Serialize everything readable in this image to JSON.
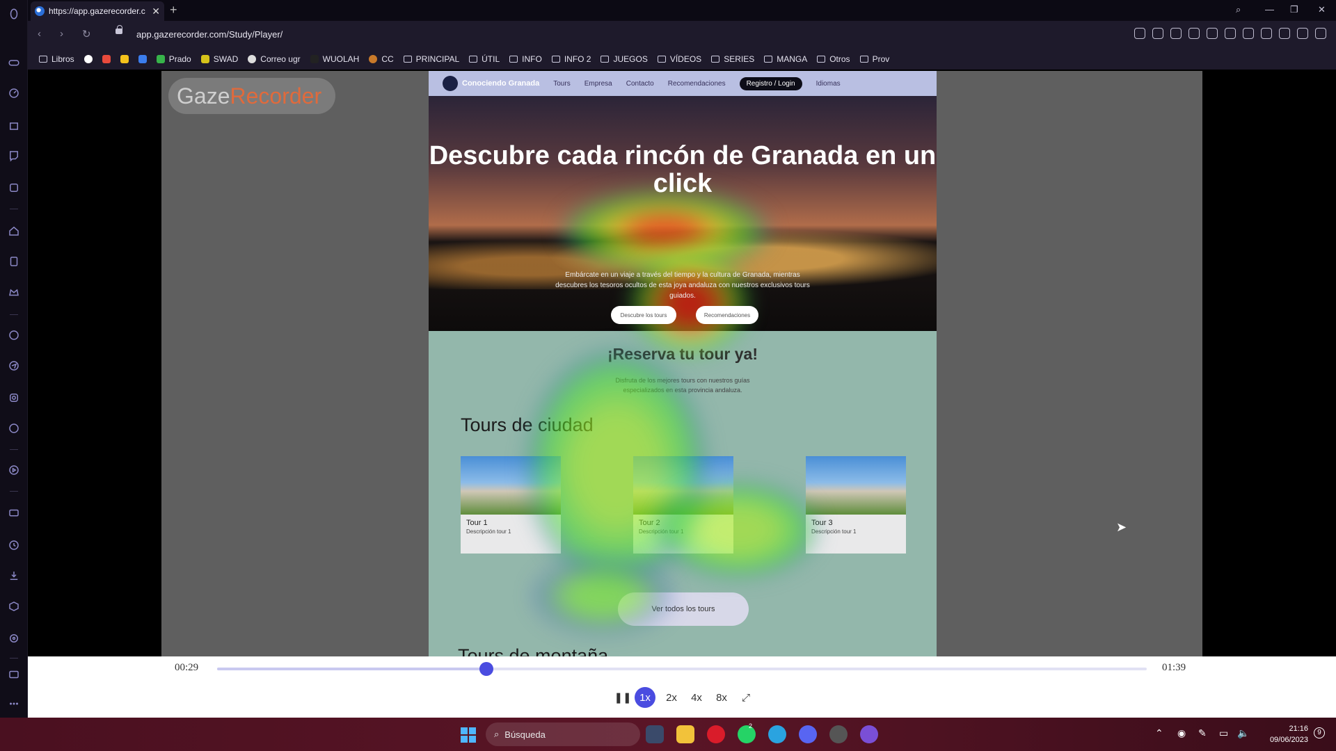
{
  "browser": {
    "tab_title": "https://app.gazerecorder.c",
    "url": "app.gazerecorder.com/Study/Player/",
    "bookmarks": [
      "Libros",
      "Prado",
      "SWAD",
      "Correo ugr",
      "WUOLAH",
      "CC",
      "PRINCIPAL",
      "ÚTIL",
      "INFO",
      "INFO 2",
      "JUEGOS",
      "VÍDEOS",
      "SERIES",
      "MANGA",
      "Otros",
      "Prov"
    ]
  },
  "player": {
    "logo_part1": "Gaze",
    "logo_part2": "Recorder",
    "time_current": "00:29",
    "time_total": "01:39",
    "progress_fraction": 0.29,
    "speeds": [
      "1x",
      "2x",
      "4x",
      "8x"
    ],
    "active_speed": "1x"
  },
  "site": {
    "brand": "Conociendo Granada",
    "nav": [
      "Tours",
      "Empresa",
      "Contacto",
      "Recomendaciones",
      "Registro / Login",
      "Idiomas"
    ],
    "hero_title": "Descubre cada rincón de Granada en un click",
    "hero_text": "Embárcate en un viaje a través del tiempo y la cultura de Granada, mientras descubres los tesoros ocultos de esta joya andaluza con nuestros exclusivos tours guiados.",
    "hero_btn_1": "Descubre los tours",
    "hero_btn_2": "Recomendaciones",
    "reserve_title": "¡Reserva tu tour ya!",
    "reserve_text": "Disfruta de los mejores tours con nuestros guías especializados en esta provincia andaluza.",
    "section_city": "Tours de ciudad",
    "tours": [
      {
        "name": "Tour 1",
        "desc": "Descripción tour 1"
      },
      {
        "name": "Tour 2",
        "desc": "Descripción tour 1"
      },
      {
        "name": "Tour 3",
        "desc": "Descripción tour 1"
      }
    ],
    "all_tours_btn": "Ver todos los tours",
    "section_mountain": "Tours de montaña"
  },
  "taskbar": {
    "search_placeholder": "Búsqueda",
    "time": "21:16",
    "date": "09/06/2023",
    "notification_count": "9",
    "whatsapp_badge": "2"
  },
  "colors": {
    "accent": "#4a4ce0",
    "sidebar_icon": "#8b88c6"
  }
}
